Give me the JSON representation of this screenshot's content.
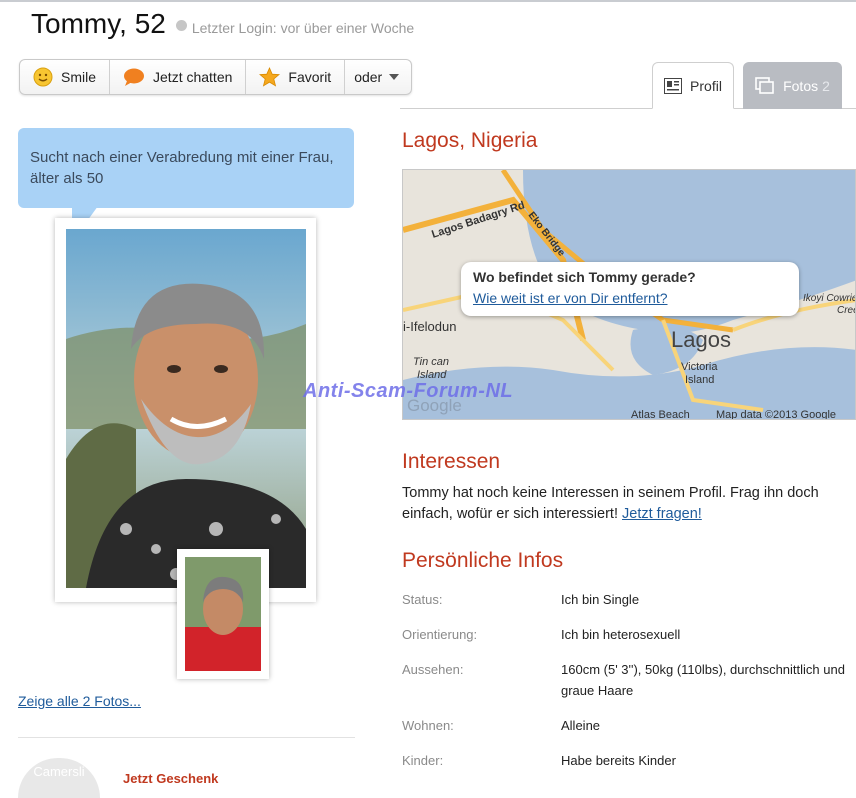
{
  "header": {
    "title": "Tommy, 52",
    "last_login": "Letzter Login: vor über einer Woche"
  },
  "actions": {
    "smile": "Smile",
    "chat": "Jetzt chatten",
    "favorite": "Favorit",
    "more": "oder"
  },
  "tabs": {
    "profile": "Profil",
    "photos": "Fotos",
    "photos_count": "2"
  },
  "sidebar": {
    "bubble": "Sucht nach einer Verabredung mit einer Frau, älter als 50",
    "show_all_photos": "Zeige alle 2 Fotos...",
    "gift_logo_text": "Camersli",
    "gift_label": "Jetzt Geschenk"
  },
  "location": {
    "title": "Lagos, Nigeria",
    "map_popup_question": "Wo befindet sich Tommy gerade?",
    "map_popup_link": "Wie weit ist er von Dir entfernt?",
    "map_labels": {
      "road1": "Lagos Badagry Rd",
      "road2": "Eko Bridge",
      "place1": "i-Ifelodun",
      "city": "Lagos",
      "place2": "Tin can",
      "place2b": "Island",
      "place3": "Victoria",
      "place3b": "Island",
      "place4": "Ikoyi Cowries",
      "place4b": "Creek",
      "place5": "Atlas Beach",
      "logo": "Google",
      "attribution": "Map data ©2013 Google"
    }
  },
  "watermark": "Anti-Scam-Forum-NL",
  "interests": {
    "title": "Interessen",
    "text": "Tommy hat noch keine Interessen in seinem Profil. Frag ihn doch einfach, wofür er sich interessiert!",
    "link": "Jetzt fragen!"
  },
  "personal": {
    "title": "Persönliche Infos",
    "rows": [
      {
        "label": "Status:",
        "value": "Ich bin Single"
      },
      {
        "label": "Orientierung:",
        "value": "Ich bin heterosexuell"
      },
      {
        "label": "Aussehen:",
        "value": "160cm (5' 3''), 50kg (110lbs), durchschnittlich und graue Haare"
      },
      {
        "label": "Wohnen:",
        "value": "Alleine"
      },
      {
        "label": "Kinder:",
        "value": "Habe bereits Kinder"
      }
    ]
  },
  "colors": {
    "accent_red": "#c0391f",
    "link_blue": "#1f5b9b",
    "bubble_blue": "#a9d2f6",
    "tab_inactive": "#b9bcc2"
  }
}
